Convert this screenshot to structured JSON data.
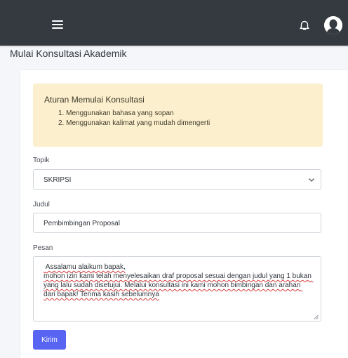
{
  "page": {
    "title": "Mulai Konsultasi Akademik"
  },
  "header": {
    "menu_icon": "hamburger-icon",
    "notification_icon": "bell-icon",
    "avatar_icon": "user-avatar-icon"
  },
  "rules": {
    "title": "Aturan Memulai Konsultasi",
    "items": [
      "1. Menggunakan bahasa yang sopan",
      "2. Menggunakan kalimat yang mudah dimengerti"
    ]
  },
  "form": {
    "topic_label": "Topik",
    "topic_value": "SKRIPSI",
    "title_label": "Judul",
    "title_value": "Pembimbingan Proposal",
    "message_label": "Pesan",
    "message_value": " Assalamu alaikum bapak,\nmohon izin kami telah menyelesaikan draf proposal sesuai dengan judul yang 1 bukan yang lalu sudah disetujui. Melalui konsultasi ini kami mohon bimbingan dan arahan dari bapak! Terima kasih sebelumnya",
    "submit_label": "Kirim"
  },
  "colors": {
    "topbar": "#343a40",
    "alert_bg": "#fcefcd",
    "primary": "#5865f2",
    "spell_error": "#d23c3c"
  }
}
